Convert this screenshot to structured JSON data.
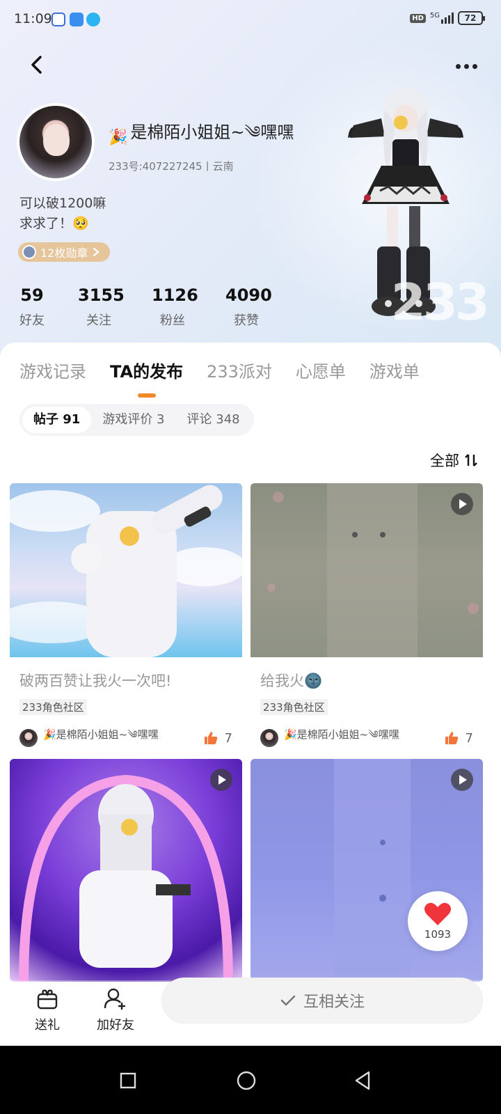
{
  "status_bar": {
    "time": "11:09",
    "hd": "HD",
    "network": "5G",
    "battery": "72"
  },
  "profile": {
    "nickname": "是棉陌小姐姐~༄嘿嘿",
    "id_line": "233号:407227245丨云南",
    "bio_line1": "可以破1200嘛",
    "bio_line2": "求求了！🥺",
    "badges": "12枚勋章",
    "watermark": "233"
  },
  "stats": [
    {
      "value": "59",
      "label": "好友"
    },
    {
      "value": "3155",
      "label": "关注"
    },
    {
      "value": "1126",
      "label": "粉丝"
    },
    {
      "value": "4090",
      "label": "获赞"
    }
  ],
  "tabs": [
    {
      "label": "游戏记录",
      "active": false
    },
    {
      "label": "TA的发布",
      "active": true
    },
    {
      "label": "233派对",
      "active": false
    },
    {
      "label": "心愿单",
      "active": false
    },
    {
      "label": "游戏单",
      "active": false
    }
  ],
  "sub_tabs": [
    {
      "label": "帖子 91",
      "active": true
    },
    {
      "label": "游戏评价 3",
      "active": false
    },
    {
      "label": "评论 348",
      "active": false
    }
  ],
  "filter": {
    "label": "全部",
    "icon": "sort-icon"
  },
  "posts": [
    {
      "title": "破两百赞让我火一次吧!",
      "community": "233角色社区",
      "author": "🎉是棉陌小姐姐~༄嘿嘿",
      "likes": "7",
      "is_video": false
    },
    {
      "title": "给我火🌚",
      "community": "233角色社区",
      "author": "🎉是棉陌小姐姐~༄嘿嘿",
      "likes": "7",
      "is_video": true
    },
    {
      "title": "",
      "community": "",
      "author": "",
      "likes": "",
      "is_video": true
    },
    {
      "title": "",
      "community": "",
      "author": "",
      "likes": "",
      "is_video": true
    }
  ],
  "float_like": {
    "count": "1093"
  },
  "actions": {
    "gift": "送礼",
    "add_friend": "加好友",
    "follow": "互相关注"
  },
  "colors": {
    "accent": "#f08a28",
    "badge": "#e7c59a",
    "like": "#f2763a"
  }
}
